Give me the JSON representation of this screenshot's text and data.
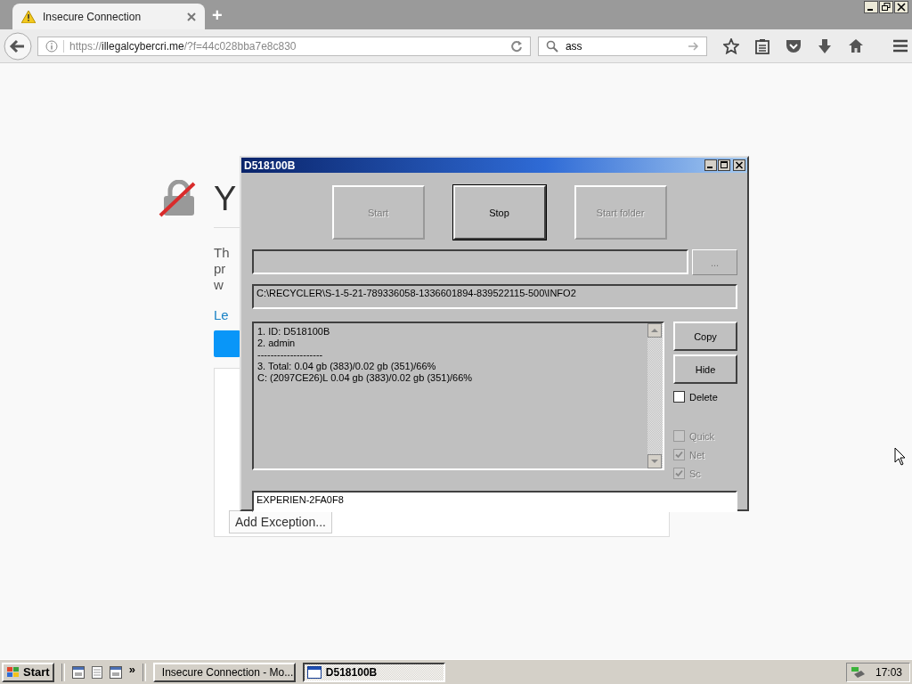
{
  "browser": {
    "tabs": [
      {
        "title": "Insecure Connection",
        "selected": true
      }
    ],
    "new_tab": "+",
    "address": {
      "scheme": "https://",
      "host": "illegalcybercri.me",
      "rest": "/?f=44c028bba7e8c830"
    },
    "search": {
      "value": "ass"
    }
  },
  "page": {
    "title": "Y",
    "lines": [
      "Th",
      "pr",
      "w"
    ],
    "link": "Le",
    "exception_button": "Add Exception..."
  },
  "dialog": {
    "title": "D518100B",
    "buttons": [
      {
        "label": "Start",
        "disabled": true
      },
      {
        "label": "Stop",
        "disabled": false
      },
      {
        "label": "Start folder",
        "disabled": true
      }
    ],
    "browse_button": "...",
    "path": "C:\\RECYCLER\\S-1-5-21-789336058-1336601894-839522115-500\\INFO2",
    "log": [
      "1. ID: D518100B",
      "2. admin",
      "--------------------",
      "3. Total: 0.04 gb (383)/0.02 gb (351)/66%",
      "C: (2097CE26)L 0.04 gb (383)/0.02 gb (351)/66%"
    ],
    "side_buttons": [
      "Copy",
      "Hide"
    ],
    "options": [
      {
        "label": "Delete",
        "checked": false,
        "disabled": false
      },
      {
        "label": "Quick",
        "checked": false,
        "disabled": true
      },
      {
        "label": "Net",
        "checked": true,
        "disabled": true
      },
      {
        "label": "Sc",
        "checked": true,
        "disabled": true
      }
    ],
    "name_field": "EXPERIEN-2FA0F8"
  },
  "taskbar": {
    "start": "Start",
    "chevron": "»",
    "tasks": [
      {
        "label": "Insecure Connection - Mo...",
        "kind": "browser",
        "selected": false
      },
      {
        "label": "D518100B",
        "kind": "window",
        "selected": true
      }
    ],
    "clock": "17:03"
  }
}
